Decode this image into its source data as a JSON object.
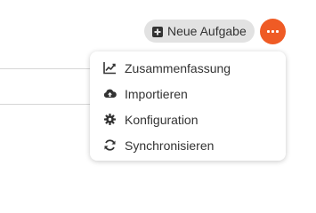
{
  "header": {
    "new_task_label": "Neue Aufgabe",
    "new_task_icon": "plus-square-icon",
    "more_icon": "ellipsis-icon"
  },
  "menu": {
    "items": [
      {
        "label": "Zusammenfassung",
        "icon": "line-chart-icon"
      },
      {
        "label": "Importieren",
        "icon": "cloud-upload-icon"
      },
      {
        "label": "Konfiguration",
        "icon": "gear-icon"
      },
      {
        "label": "Synchronisieren",
        "icon": "sync-icon"
      }
    ]
  },
  "colors": {
    "accent": "#ef5b25",
    "button_bg": "#e2e2e2",
    "text": "#333333"
  }
}
